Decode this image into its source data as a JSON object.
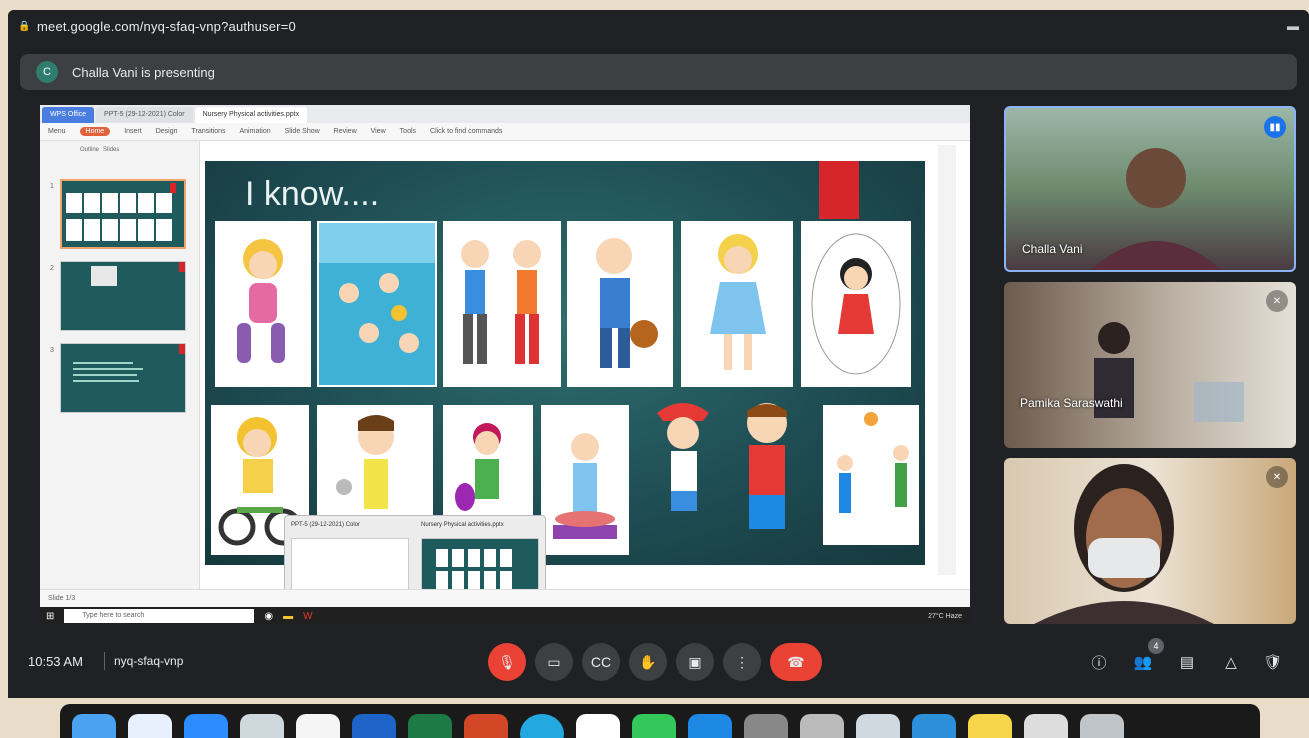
{
  "browser": {
    "url": "meet.google.com/nyq-sfaq-vnp?authuser=0",
    "menu_icon": "minimize-icon"
  },
  "banner": {
    "avatar": "C",
    "text": "Challa Vani is presenting"
  },
  "presentation": {
    "window_tabs": [
      "WPS Office",
      "PPT-5 (29-12-2021) Color",
      "Nursery Physical activities.pptx"
    ],
    "ribbon": [
      "Menu",
      "Insert",
      "Design",
      "Transitions",
      "Animation",
      "Slide Show",
      "Review",
      "View",
      "Tools",
      "Click to find commands"
    ],
    "ribbon_active": "Home",
    "panel_tabs": [
      "Outline",
      "Slides"
    ],
    "slide_numbers": [
      "1",
      "2",
      "3"
    ],
    "slide_title": "I know....",
    "status": "Slide 1/3",
    "taskbar_search": "Type here to search",
    "taskbar_tray": "27°C Haze",
    "popup_labels": [
      "PPT-5 (29-12-2021) Color",
      "Nursery Physical activities.pptx"
    ]
  },
  "participants": [
    {
      "name": "Challa Vani"
    },
    {
      "name": "Pamika Saraswathi"
    },
    {
      "name": ""
    }
  ],
  "controls": {
    "time": "10:53 AM",
    "code": "nyq-sfaq-vnp",
    "people_count": "4"
  },
  "colors": {
    "meet_bg": "#202124",
    "end_call": "#ea4335",
    "slide_bg": "#1d4b51",
    "accent_red": "#d7262b"
  }
}
